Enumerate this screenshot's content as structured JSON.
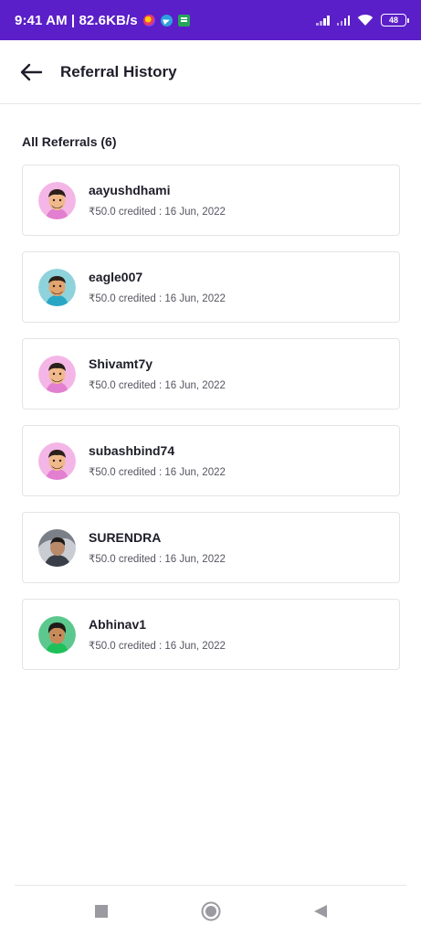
{
  "status_bar": {
    "time_speed": "9:41 AM | 82.6KB/s",
    "battery": "48",
    "bg_color": "#5a1fc8"
  },
  "header": {
    "title": "Referral History",
    "back_icon": "arrow-left-icon"
  },
  "section": {
    "title": "All Referrals (6)"
  },
  "referrals": [
    {
      "username": "aayushdhami",
      "credit": "₹50.0 credited : 16 Jun, 2022",
      "avatar_bg": "#f4b6e6",
      "avatar": "cartoon-avatar"
    },
    {
      "username": "eagle007",
      "credit": "₹50.0 credited : 16 Jun, 2022",
      "avatar_bg": "#8ed3dc",
      "avatar": "cartoon-avatar"
    },
    {
      "username": "Shivamt7y",
      "credit": "₹50.0 credited : 16 Jun, 2022",
      "avatar_bg": "#f4b6e6",
      "avatar": "cartoon-avatar"
    },
    {
      "username": "subashbind74",
      "credit": "₹50.0 credited : 16 Jun, 2022",
      "avatar_bg": "#f4b6e6",
      "avatar": "cartoon-avatar"
    },
    {
      "username": "SURENDRA",
      "credit": "₹50.0 credited : 16 Jun, 2022",
      "avatar_bg": "#c9ccd2",
      "avatar": "photo-avatar"
    },
    {
      "username": "Abhinav1",
      "credit": "₹50.0 credited : 16 Jun, 2022",
      "avatar_bg": "#5cc88e",
      "avatar": "cartoon-avatar"
    }
  ],
  "nav_bar": {
    "icons": [
      "square-recents-icon",
      "circle-home-icon",
      "triangle-back-icon"
    ]
  }
}
